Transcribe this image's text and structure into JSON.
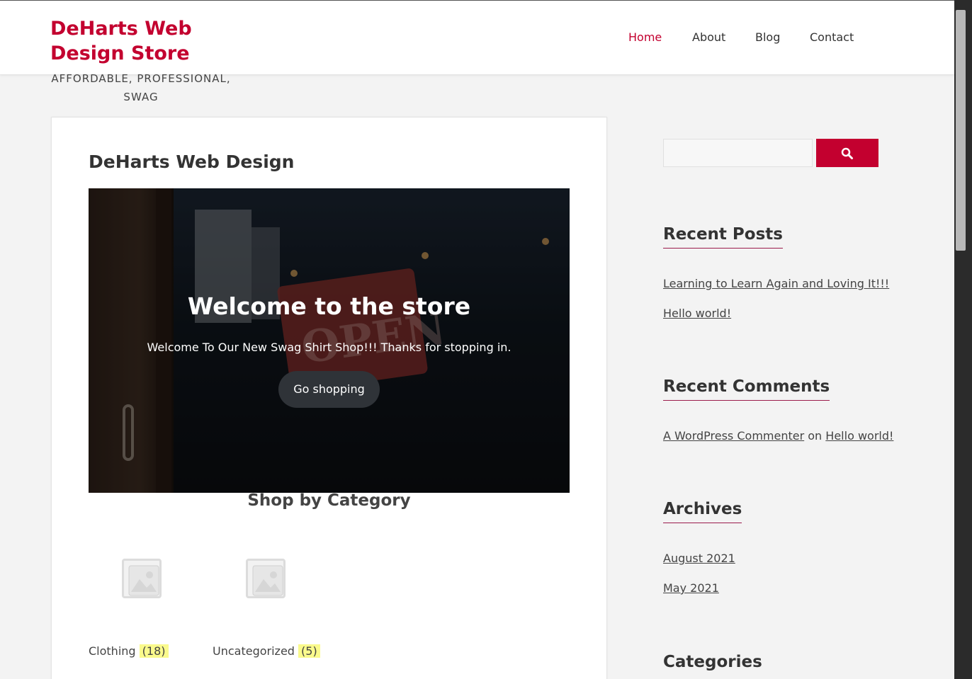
{
  "header": {
    "site_title": "DeHarts Web Design Store",
    "tagline": "AFFORDABLE, PROFESSIONAL, SWAG",
    "nav": [
      "Home",
      "About",
      "Blog",
      "Contact"
    ],
    "active_nav": "Home",
    "brand_color": "#c3002f"
  },
  "main": {
    "page_title": "DeHarts Web Design",
    "hero": {
      "title": "Welcome to the store",
      "text": "Welcome To Our New Swag Shirt Shop!!! Thanks for stopping in.",
      "button": "Go shopping",
      "sign_text": "OPEN"
    },
    "section_title": "Shop by Category",
    "categories": [
      {
        "name": "Clothing",
        "count": "(18)"
      },
      {
        "name": "Uncategorized",
        "count": "(5)"
      }
    ]
  },
  "sidebar": {
    "search": {
      "placeholder": "",
      "button_icon": "search-icon"
    },
    "recent_posts": {
      "title": "Recent Posts",
      "items": [
        "Learning to Learn Again and Loving It!!!",
        "Hello world!"
      ]
    },
    "recent_comments": {
      "title": "Recent Comments",
      "author": "A WordPress Commenter",
      "on": "on",
      "post": "Hello world!"
    },
    "archives": {
      "title": "Archives",
      "items": [
        "August 2021",
        "May 2021"
      ]
    },
    "categories": {
      "title": "Categories"
    }
  }
}
